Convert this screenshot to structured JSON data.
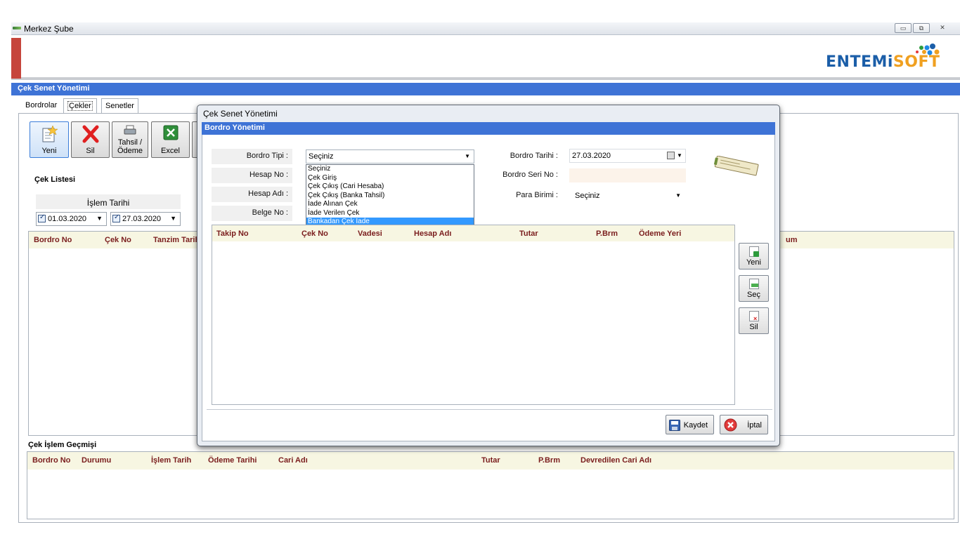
{
  "window": {
    "title": "Merkez Şube",
    "controls": [
      "▭",
      "⧉",
      "✕"
    ]
  },
  "brand": {
    "logo_main": "ENTEMi",
    "logo_accent": "SOFT",
    "logo_colors": [
      "#1b5ea8",
      "#f0a020",
      "#2d9b3c",
      "#1e88e5"
    ]
  },
  "section": {
    "title": "Çek Senet Yönetimi",
    "accent_color": "#3e73d6"
  },
  "tabs": [
    {
      "label": "Bordrolar"
    },
    {
      "label": "Çekler",
      "selected": true
    },
    {
      "label": "Senetler"
    }
  ],
  "toolbar": {
    "new_label": "Yeni",
    "delete_label": "Sil",
    "collect_label_1": "Tahsil /",
    "collect_label_2": "Ödeme",
    "excel_label": "Excel"
  },
  "check_list": {
    "title": "Çek Listesi",
    "date_filter_label": "İşlem Tarihi",
    "date_from": "01.03.2020",
    "date_to": "27.03.2020",
    "columns": [
      "Bordro No",
      "Çek No",
      "Tanzim Tarih"
    ],
    "right_column": "um"
  },
  "history": {
    "title": "Çek İşlem Geçmişi",
    "columns": [
      "Bordro No",
      "Durumu",
      "İşlem Tarih",
      "Ödeme Tarihi",
      "Cari Adı",
      "Tutar",
      "P.Brm",
      "Devredilen Cari Adı"
    ]
  },
  "dialog": {
    "window_title": "Çek Senet Yönetimi",
    "header": "Bordro Yönetimi",
    "fields": {
      "type_label": "Bordro Tipi :",
      "type_value": "Seçiniz",
      "account_no_label": "Hesap No :",
      "account_name_label": "Hesap Adı :",
      "document_no_label": "Belge No :",
      "date_label": "Bordro Tarihi :",
      "date_value": "27.03.2020",
      "serial_label": "Bordro Seri No :",
      "currency_label": "Para Birimi :",
      "currency_value": "Seçiniz"
    },
    "type_options": [
      "Seçiniz",
      "Çek Giriş",
      "Çek Çıkış (Cari Hesaba)",
      "Çek Çıkış (Banka Tahsil)",
      "İade Alınan Çek",
      "İade Verilen Çek",
      "Bankadan Çek İade"
    ],
    "type_highlighted": "Bankadan Çek İade",
    "grid_columns": [
      "Takip No",
      "Çek No",
      "Vadesi",
      "Hesap Adı",
      "Tutar",
      "P.Brm",
      "Ödeme Yeri"
    ],
    "side_buttons": {
      "new": "Yeni",
      "select": "Seç",
      "delete": "Sil"
    },
    "save_label": "Kaydet",
    "cancel_label": "İptal"
  }
}
